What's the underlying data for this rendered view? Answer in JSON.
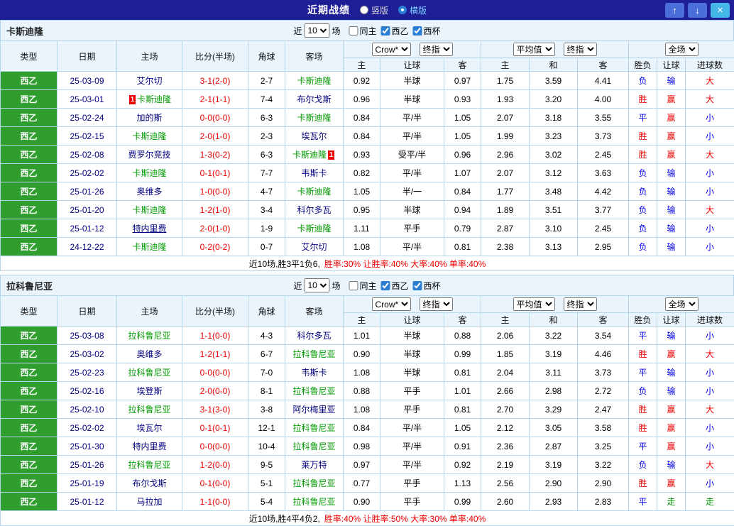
{
  "colors": {
    "titlebar": "#1e1e96",
    "panel": "#e9f4fc",
    "league-green": "#2f9e2f",
    "team-green": "#009900",
    "red": "#ee0000",
    "blue": "#0000ee",
    "navy": "#000080",
    "accent-blue": "#2a7fd4"
  },
  "titlebar": {
    "title": "近期战绩",
    "view_options": [
      {
        "label": "竖版",
        "selected": false
      },
      {
        "label": "横版",
        "selected": true
      }
    ],
    "buttons": {
      "up": "↑",
      "down": "↓",
      "close": "×"
    }
  },
  "filter": {
    "near_label": "近",
    "count": "10",
    "games_label": "场",
    "checkboxes": [
      {
        "label": "同主",
        "checked": false
      },
      {
        "label": "西乙",
        "checked": true
      },
      {
        "label": "西杯",
        "checked": true
      }
    ]
  },
  "columns": {
    "type": "类型",
    "date": "日期",
    "home": "主场",
    "score": "比分(半场)",
    "corner": "角球",
    "away": "客场",
    "asia_selects": [
      "Crow*",
      "终指"
    ],
    "europe_selects": [
      "平均值",
      "终指"
    ],
    "full_select": "全场",
    "sub": {
      "asia": [
        "主",
        "让球",
        "客"
      ],
      "europe": [
        "主",
        "和",
        "客"
      ],
      "result": [
        "胜负",
        "让球",
        "进球数"
      ]
    }
  },
  "sections": [
    {
      "team": "卡斯迪隆",
      "summary_prefix": "近10场,胜3平1负6,",
      "summary_stats": "胜率:30% 让胜率:40% 大率:40% 单率:40%",
      "rows": [
        {
          "league": "西乙",
          "date": "25-03-09",
          "home": "艾尔切",
          "away": "卡斯迪隆",
          "away_hl": true,
          "score": "3-1(2-0)",
          "corner": "2-7",
          "asia": [
            "0.92",
            "半球",
            "0.97"
          ],
          "euro": [
            "1.75",
            "3.59",
            "4.41"
          ],
          "results": [
            {
              "t": "负",
              "c": "blue"
            },
            {
              "t": "输",
              "c": "blue"
            },
            {
              "t": "大",
              "c": "red"
            }
          ]
        },
        {
          "league": "西乙",
          "date": "25-03-01",
          "home": "卡斯迪隆",
          "home_hl": true,
          "home_badge": "1",
          "away": "布尔戈斯",
          "score": "2-1(1-1)",
          "corner": "7-4",
          "asia": [
            "0.96",
            "半球",
            "0.93"
          ],
          "euro": [
            "1.93",
            "3.20",
            "4.00"
          ],
          "results": [
            {
              "t": "胜",
              "c": "red"
            },
            {
              "t": "赢",
              "c": "red"
            },
            {
              "t": "大",
              "c": "red"
            }
          ]
        },
        {
          "league": "西乙",
          "date": "25-02-24",
          "home": "加的斯",
          "away": "卡斯迪隆",
          "away_hl": true,
          "score": "0-0(0-0)",
          "corner": "6-3",
          "asia": [
            "0.84",
            "平/半",
            "1.05"
          ],
          "euro": [
            "2.07",
            "3.18",
            "3.55"
          ],
          "results": [
            {
              "t": "平",
              "c": "blue"
            },
            {
              "t": "赢",
              "c": "red"
            },
            {
              "t": "小",
              "c": "blue"
            }
          ]
        },
        {
          "league": "西乙",
          "date": "25-02-15",
          "home": "卡斯迪隆",
          "home_hl": true,
          "away": "埃瓦尔",
          "score": "2-0(1-0)",
          "corner": "2-3",
          "asia": [
            "0.84",
            "平/半",
            "1.05"
          ],
          "euro": [
            "1.99",
            "3.23",
            "3.73"
          ],
          "results": [
            {
              "t": "胜",
              "c": "red"
            },
            {
              "t": "赢",
              "c": "red"
            },
            {
              "t": "小",
              "c": "blue"
            }
          ]
        },
        {
          "league": "西乙",
          "date": "25-02-08",
          "home": "费罗尔竞技",
          "away": "卡斯迪隆",
          "away_hl": true,
          "away_badge": "1",
          "score": "1-3(0-2)",
          "corner": "6-3",
          "asia": [
            "0.93",
            "受平/半",
            "0.96"
          ],
          "euro": [
            "2.96",
            "3.02",
            "2.45"
          ],
          "results": [
            {
              "t": "胜",
              "c": "red"
            },
            {
              "t": "赢",
              "c": "red"
            },
            {
              "t": "大",
              "c": "red"
            }
          ]
        },
        {
          "league": "西乙",
          "date": "25-02-02",
          "home": "卡斯迪隆",
          "home_hl": true,
          "away": "韦斯卡",
          "score": "0-1(0-1)",
          "corner": "7-7",
          "asia": [
            "0.82",
            "平/半",
            "1.07"
          ],
          "euro": [
            "2.07",
            "3.12",
            "3.63"
          ],
          "results": [
            {
              "t": "负",
              "c": "blue"
            },
            {
              "t": "输",
              "c": "blue"
            },
            {
              "t": "小",
              "c": "blue"
            }
          ]
        },
        {
          "league": "西乙",
          "date": "25-01-26",
          "home": "奥维多",
          "away": "卡斯迪隆",
          "away_hl": true,
          "score": "1-0(0-0)",
          "corner": "4-7",
          "asia": [
            "1.05",
            "半/一",
            "0.84"
          ],
          "euro": [
            "1.77",
            "3.48",
            "4.42"
          ],
          "results": [
            {
              "t": "负",
              "c": "blue"
            },
            {
              "t": "输",
              "c": "blue"
            },
            {
              "t": "小",
              "c": "blue"
            }
          ]
        },
        {
          "league": "西乙",
          "date": "25-01-20",
          "home": "卡斯迪隆",
          "home_hl": true,
          "away": "科尔多瓦",
          "score": "1-2(1-0)",
          "corner": "3-4",
          "asia": [
            "0.95",
            "半球",
            "0.94"
          ],
          "euro": [
            "1.89",
            "3.51",
            "3.77"
          ],
          "results": [
            {
              "t": "负",
              "c": "blue"
            },
            {
              "t": "输",
              "c": "blue"
            },
            {
              "t": "大",
              "c": "red"
            }
          ]
        },
        {
          "league": "西乙",
          "date": "25-01-12",
          "home": "特内里费",
          "home_ul": true,
          "away": "卡斯迪隆",
          "away_hl": true,
          "score": "2-0(1-0)",
          "corner": "1-9",
          "asia": [
            "1.11",
            "平手",
            "0.79"
          ],
          "euro": [
            "2.87",
            "3.10",
            "2.45"
          ],
          "results": [
            {
              "t": "负",
              "c": "blue"
            },
            {
              "t": "输",
              "c": "blue"
            },
            {
              "t": "小",
              "c": "blue"
            }
          ]
        },
        {
          "league": "西乙",
          "date": "24-12-22",
          "home": "卡斯迪隆",
          "home_hl": true,
          "away": "艾尔切",
          "score": "0-2(0-2)",
          "corner": "0-7",
          "asia": [
            "1.08",
            "平/半",
            "0.81"
          ],
          "euro": [
            "2.38",
            "3.13",
            "2.95"
          ],
          "results": [
            {
              "t": "负",
              "c": "blue"
            },
            {
              "t": "输",
              "c": "blue"
            },
            {
              "t": "小",
              "c": "blue"
            }
          ]
        }
      ]
    },
    {
      "team": "拉科鲁尼亚",
      "summary_prefix": "近10场,胜4平4负2,",
      "summary_stats": "胜率:40% 让胜率:50% 大率:30% 单率:40%",
      "rows": [
        {
          "league": "西乙",
          "date": "25-03-08",
          "home": "拉科鲁尼亚",
          "home_hl": true,
          "away": "科尔多瓦",
          "score": "1-1(0-0)",
          "corner": "4-3",
          "asia": [
            "1.01",
            "半球",
            "0.88"
          ],
          "euro": [
            "2.06",
            "3.22",
            "3.54"
          ],
          "results": [
            {
              "t": "平",
              "c": "blue"
            },
            {
              "t": "输",
              "c": "blue"
            },
            {
              "t": "小",
              "c": "blue"
            }
          ]
        },
        {
          "league": "西乙",
          "date": "25-03-02",
          "home": "奥维多",
          "away": "拉科鲁尼亚",
          "away_hl": true,
          "score": "1-2(1-1)",
          "corner": "6-7",
          "asia": [
            "0.90",
            "半球",
            "0.99"
          ],
          "euro": [
            "1.85",
            "3.19",
            "4.46"
          ],
          "results": [
            {
              "t": "胜",
              "c": "red"
            },
            {
              "t": "赢",
              "c": "red"
            },
            {
              "t": "大",
              "c": "red"
            }
          ]
        },
        {
          "league": "西乙",
          "date": "25-02-23",
          "home": "拉科鲁尼亚",
          "home_hl": true,
          "away": "韦斯卡",
          "score": "0-0(0-0)",
          "corner": "7-0",
          "asia": [
            "1.08",
            "半球",
            "0.81"
          ],
          "euro": [
            "2.04",
            "3.11",
            "3.73"
          ],
          "results": [
            {
              "t": "平",
              "c": "blue"
            },
            {
              "t": "输",
              "c": "blue"
            },
            {
              "t": "小",
              "c": "blue"
            }
          ]
        },
        {
          "league": "西乙",
          "date": "25-02-16",
          "home": "埃登斯",
          "away": "拉科鲁尼亚",
          "away_hl": true,
          "score": "2-0(0-0)",
          "corner": "8-1",
          "asia": [
            "0.88",
            "平手",
            "1.01"
          ],
          "euro": [
            "2.66",
            "2.98",
            "2.72"
          ],
          "results": [
            {
              "t": "负",
              "c": "blue"
            },
            {
              "t": "输",
              "c": "blue"
            },
            {
              "t": "小",
              "c": "blue"
            }
          ]
        },
        {
          "league": "西乙",
          "date": "25-02-10",
          "home": "拉科鲁尼亚",
          "home_hl": true,
          "away": "阿尔梅里亚",
          "score": "3-1(3-0)",
          "corner": "3-8",
          "asia": [
            "1.08",
            "平手",
            "0.81"
          ],
          "euro": [
            "2.70",
            "3.29",
            "2.47"
          ],
          "results": [
            {
              "t": "胜",
              "c": "red"
            },
            {
              "t": "赢",
              "c": "red"
            },
            {
              "t": "大",
              "c": "red"
            }
          ]
        },
        {
          "league": "西乙",
          "date": "25-02-02",
          "home": "埃瓦尔",
          "away": "拉科鲁尼亚",
          "away_hl": true,
          "score": "0-1(0-1)",
          "corner": "12-1",
          "asia": [
            "0.84",
            "平/半",
            "1.05"
          ],
          "euro": [
            "2.12",
            "3.05",
            "3.58"
          ],
          "results": [
            {
              "t": "胜",
              "c": "red"
            },
            {
              "t": "赢",
              "c": "red"
            },
            {
              "t": "小",
              "c": "blue"
            }
          ]
        },
        {
          "league": "西乙",
          "date": "25-01-30",
          "home": "特内里费",
          "away": "拉科鲁尼亚",
          "away_hl": true,
          "score": "0-0(0-0)",
          "corner": "10-4",
          "asia": [
            "0.98",
            "平/半",
            "0.91"
          ],
          "euro": [
            "2.36",
            "2.87",
            "3.25"
          ],
          "results": [
            {
              "t": "平",
              "c": "blue"
            },
            {
              "t": "赢",
              "c": "red"
            },
            {
              "t": "小",
              "c": "blue"
            }
          ]
        },
        {
          "league": "西乙",
          "date": "25-01-26",
          "home": "拉科鲁尼亚",
          "home_hl": true,
          "away": "莱万特",
          "score": "1-2(0-0)",
          "corner": "9-5",
          "asia": [
            "0.97",
            "平/半",
            "0.92"
          ],
          "euro": [
            "2.19",
            "3.19",
            "3.22"
          ],
          "results": [
            {
              "t": "负",
              "c": "blue"
            },
            {
              "t": "输",
              "c": "blue"
            },
            {
              "t": "大",
              "c": "red"
            }
          ]
        },
        {
          "league": "西乙",
          "date": "25-01-19",
          "home": "布尔戈斯",
          "away": "拉科鲁尼亚",
          "away_hl": true,
          "score": "0-1(0-0)",
          "corner": "5-1",
          "asia": [
            "0.77",
            "平手",
            "1.13"
          ],
          "euro": [
            "2.56",
            "2.90",
            "2.90"
          ],
          "results": [
            {
              "t": "胜",
              "c": "red"
            },
            {
              "t": "赢",
              "c": "red"
            },
            {
              "t": "小",
              "c": "blue"
            }
          ]
        },
        {
          "league": "西乙",
          "date": "25-01-12",
          "home": "马拉加",
          "away": "拉科鲁尼亚",
          "away_hl": true,
          "score": "1-1(0-0)",
          "corner": "5-4",
          "asia": [
            "0.90",
            "平手",
            "0.99"
          ],
          "euro": [
            "2.60",
            "2.93",
            "2.83"
          ],
          "results": [
            {
              "t": "平",
              "c": "blue"
            },
            {
              "t": "走",
              "c": "green"
            },
            {
              "t": "走",
              "c": "green"
            }
          ]
        }
      ]
    }
  ]
}
